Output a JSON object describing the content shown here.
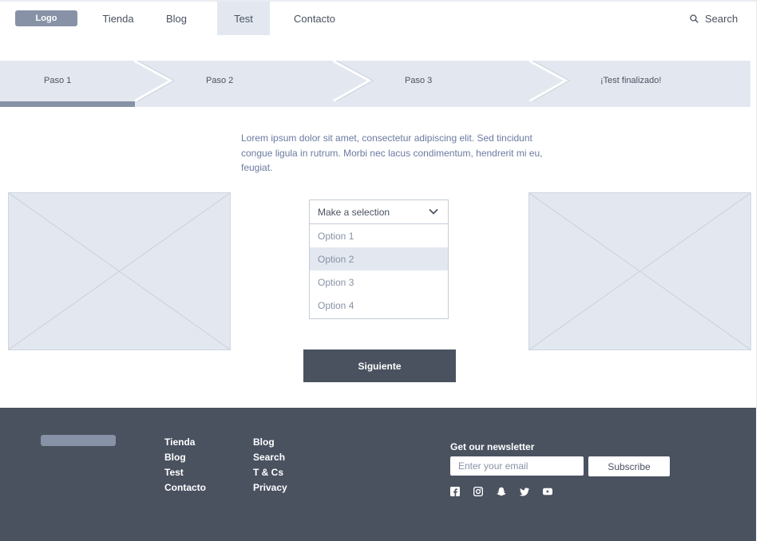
{
  "nav": {
    "logo": "Logo",
    "items": [
      "Tienda",
      "Blog",
      "Test",
      "Contacto"
    ],
    "active": "Test",
    "search_label": "Search"
  },
  "steps": {
    "items": [
      "Paso 1",
      "Paso 2",
      "Paso 3",
      "¡Test finalizado!"
    ],
    "progress_fraction": 0.18
  },
  "intro_text": "Lorem ipsum dolor sit amet, consectetur adipiscing elit. Sed tincidunt congue ligula in rutrum. Morbi nec lacus condimentum, hendrerit mi eu, feugiat.",
  "select": {
    "placeholder": "Make a selection",
    "options": [
      "Option 1",
      "Option 2",
      "Option 3",
      "Option 4"
    ],
    "highlighted": "Option 2"
  },
  "next_button": "Siguiente",
  "footer": {
    "col1": [
      "Tienda",
      "Blog",
      "Test",
      "Contacto"
    ],
    "col2": [
      "Blog",
      "Search",
      "T & Cs",
      "Privacy"
    ],
    "newsletter_title": "Get our newsletter",
    "email_placeholder": "Enter your email",
    "subscribe_label": "Subscribe",
    "social_icons": [
      "facebook-icon",
      "instagram-icon",
      "snapchat-icon",
      "twitter-icon",
      "youtube-icon"
    ]
  },
  "colors": {
    "accent": "#8792a6",
    "dark": "#4a5260",
    "light": "#e3e8f0",
    "text_muted": "#6b7aa0"
  }
}
